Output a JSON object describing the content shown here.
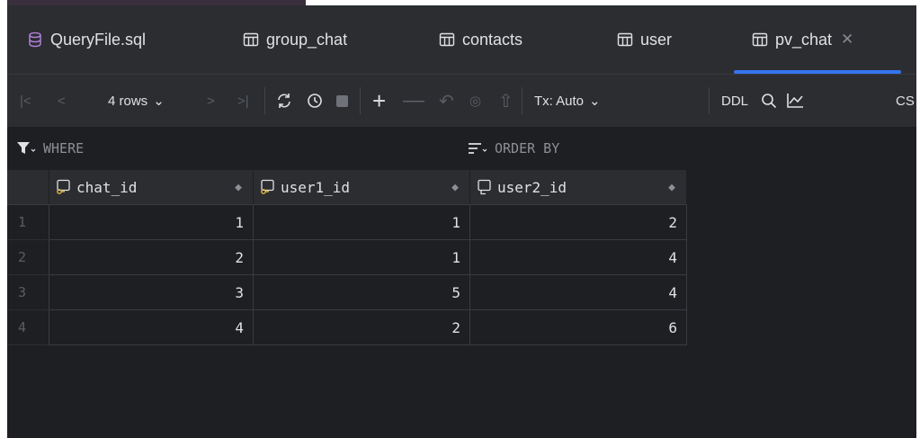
{
  "tabs": [
    {
      "label": "QueryFile.sql",
      "icon": "database-icon"
    },
    {
      "label": "group_chat",
      "icon": "table-icon"
    },
    {
      "label": "contacts",
      "icon": "table-icon"
    },
    {
      "label": "user",
      "icon": "table-icon"
    },
    {
      "label": "pv_chat",
      "icon": "table-icon",
      "active": true
    }
  ],
  "toolbar": {
    "rows_label": "4 rows",
    "tx_label": "Tx: Auto",
    "ddl_label": "DDL",
    "csv_label": "CS"
  },
  "filters": {
    "where_label": "WHERE",
    "order_label": "ORDER BY"
  },
  "table": {
    "columns": [
      {
        "name": "chat_id",
        "icon": "key-column-icon"
      },
      {
        "name": "user1_id",
        "icon": "key-column-icon"
      },
      {
        "name": "user2_id",
        "icon": "column-icon"
      }
    ],
    "rows": [
      {
        "n": "1",
        "cells": [
          "1",
          "1",
          "2"
        ]
      },
      {
        "n": "2",
        "cells": [
          "2",
          "1",
          "4"
        ]
      },
      {
        "n": "3",
        "cells": [
          "3",
          "5",
          "4"
        ]
      },
      {
        "n": "4",
        "cells": [
          "4",
          "2",
          "6"
        ]
      }
    ]
  },
  "colors": {
    "accent": "#3574f0",
    "background": "#1e1f22",
    "panel": "#2b2d30"
  }
}
